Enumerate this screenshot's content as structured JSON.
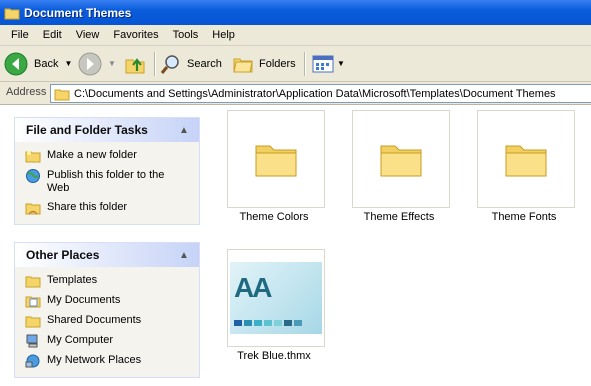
{
  "window": {
    "title": "Document Themes"
  },
  "menu": [
    "File",
    "Edit",
    "View",
    "Favorites",
    "Tools",
    "Help"
  ],
  "toolbar": {
    "back": "Back",
    "search": "Search",
    "folders": "Folders"
  },
  "address": {
    "label": "Address",
    "path": "C:\\Documents and Settings\\Administrator\\Application Data\\Microsoft\\Templates\\Document Themes"
  },
  "tasks_panel": {
    "title": "File and Folder Tasks",
    "items": [
      {
        "label": "Make a new folder",
        "icon": "new-folder-icon"
      },
      {
        "label": "Publish this folder to the Web",
        "icon": "globe-icon"
      },
      {
        "label": "Share this folder",
        "icon": "share-folder-icon"
      }
    ]
  },
  "places_panel": {
    "title": "Other Places",
    "items": [
      {
        "label": "Templates",
        "icon": "folder-icon"
      },
      {
        "label": "My Documents",
        "icon": "my-documents-icon"
      },
      {
        "label": "Shared Documents",
        "icon": "folder-icon"
      },
      {
        "label": "My Computer",
        "icon": "computer-icon"
      },
      {
        "label": "My Network Places",
        "icon": "network-icon"
      }
    ]
  },
  "files": [
    {
      "name": "Theme Colors",
      "type": "folder"
    },
    {
      "name": "Theme Effects",
      "type": "folder"
    },
    {
      "name": "Theme Fonts",
      "type": "folder"
    },
    {
      "name": "Trek Blue.thmx",
      "type": "theme",
      "preview_text": "AA"
    }
  ]
}
